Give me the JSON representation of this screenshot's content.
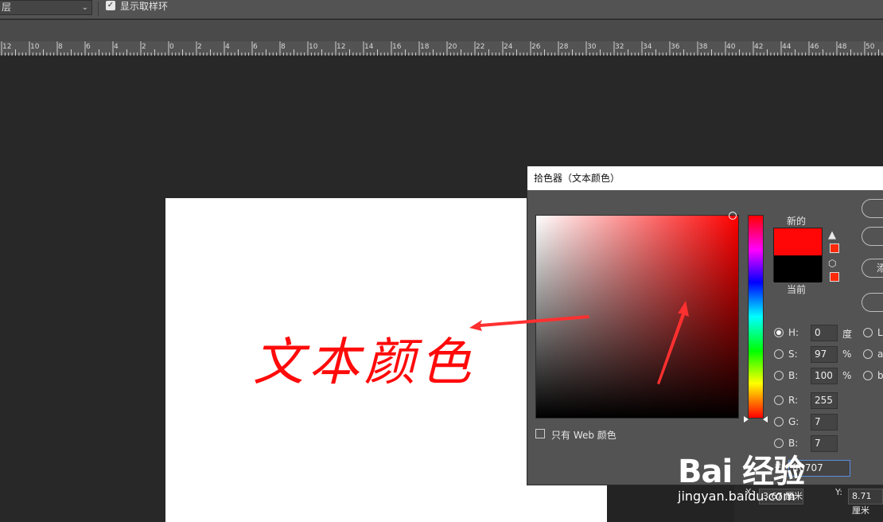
{
  "options_bar": {
    "layer_dropdown": "层",
    "show_sampling_ring_label": "显示取样环",
    "show_sampling_ring_checked": true
  },
  "ruler": {
    "labels": [
      "12",
      "10",
      "8",
      "6",
      "4",
      "2",
      "0",
      "2",
      "4",
      "6",
      "8",
      "10",
      "12",
      "14",
      "16",
      "18",
      "20",
      "22",
      "24",
      "26",
      "28",
      "30",
      "32",
      "34",
      "36",
      "38",
      "40",
      "42",
      "44",
      "46",
      "48",
      "50"
    ]
  },
  "canvas": {
    "document_text": "文本颜色",
    "text_color": "#ff0a0a"
  },
  "color_picker": {
    "title": "拾色器（文本颜色）",
    "new_label": "新的",
    "current_label": "当前",
    "new_color": "#ff0707",
    "current_color": "#000000",
    "web_only_label": "只有 Web 颜色",
    "web_only_checked": false,
    "hsb": [
      {
        "key": "H:",
        "value": "0",
        "unit": "度",
        "selected": true
      },
      {
        "key": "S:",
        "value": "97",
        "unit": "%",
        "selected": false
      },
      {
        "key": "B:",
        "value": "100",
        "unit": "%",
        "selected": false
      }
    ],
    "rgb": [
      {
        "key": "R:",
        "value": "255"
      },
      {
        "key": "G:",
        "value": "7"
      },
      {
        "key": "B:",
        "value": "7"
      }
    ],
    "lab_labels": [
      "L",
      "a",
      "b"
    ],
    "hex_prefix": "#",
    "hex_value": "ff0707",
    "side_button_partial": "添"
  },
  "status": {
    "x_label": "X:",
    "x_value": "3.67 厘米",
    "y_label": "Y:",
    "y_value": "8.71 厘米"
  },
  "watermark": {
    "big": "Bai 经验",
    "small": "jingyan.baidu.com"
  }
}
